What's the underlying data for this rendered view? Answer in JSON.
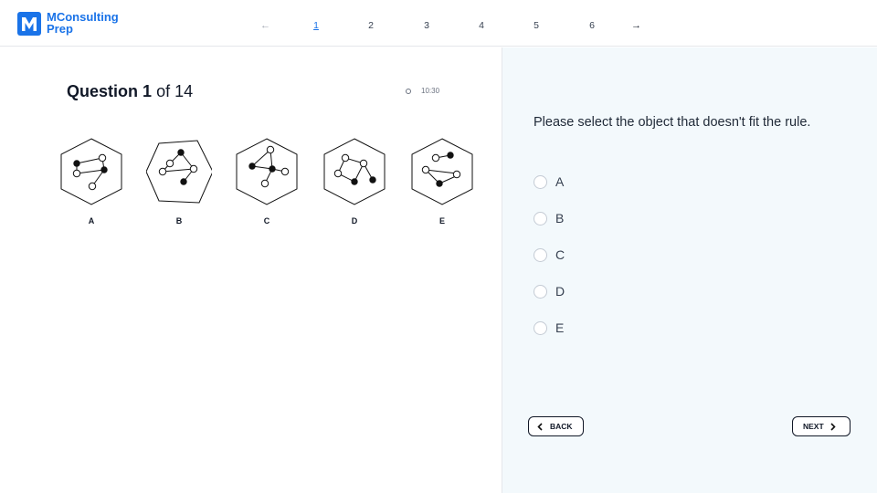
{
  "brand": {
    "name_line1": "MConsulting",
    "name_line2": "Prep",
    "logo_letter": "M",
    "color": "#1a73e8"
  },
  "pagination": {
    "prev_icon": "arrow-left-icon",
    "next_icon": "arrow-right-icon",
    "pages": [
      "1",
      "2",
      "3",
      "4",
      "5",
      "6"
    ],
    "current": "1"
  },
  "question": {
    "label": "Question",
    "number": "1",
    "of_text": "of 14",
    "timer": "10:30",
    "prompt": "Please select the object that doesn't fit the rule."
  },
  "figures": [
    "A",
    "B",
    "C",
    "D",
    "E"
  ],
  "options": [
    "A",
    "B",
    "C",
    "D",
    "E"
  ],
  "buttons": {
    "back": "BACK",
    "next": "NEXT"
  },
  "colors": {
    "accent": "#1a73e8",
    "right_panel": "#f3f9fc"
  }
}
